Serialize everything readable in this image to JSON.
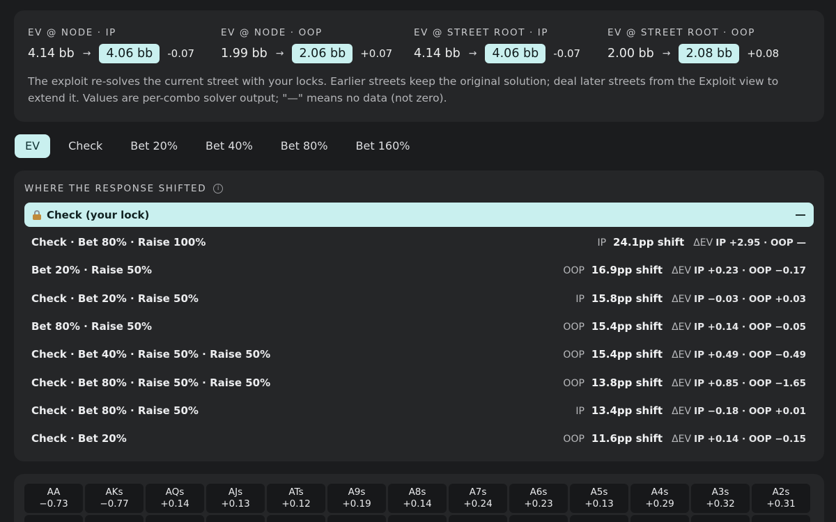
{
  "ev_summary": [
    {
      "label": "EV @ NODE · IP",
      "old": "4.14 bb",
      "arrow": "→",
      "new": "4.06 bb",
      "delta": "-0.07"
    },
    {
      "label": "EV @ NODE · OOP",
      "old": "1.99 bb",
      "arrow": "→",
      "new": "2.06 bb",
      "delta": "+0.07"
    },
    {
      "label": "EV @ STREET ROOT · IP",
      "old": "4.14 bb",
      "arrow": "→",
      "new": "4.06 bb",
      "delta": "-0.07"
    },
    {
      "label": "EV @ STREET ROOT · OOP",
      "old": "2.00 bb",
      "arrow": "→",
      "new": "2.08 bb",
      "delta": "+0.08"
    }
  ],
  "note": "The exploit re-solves the current street with your locks. Earlier streets keep the original solution; deal later streets from the Exploit view to extend it. Values are per-combo solver output; \"—\" means no data (not zero).",
  "tabs": [
    "EV",
    "Check",
    "Bet 20%",
    "Bet 40%",
    "Bet 80%",
    "Bet 160%"
  ],
  "shift_panel": {
    "heading": "WHERE THE RESPONSE SHIFTED",
    "info_glyph": "i",
    "lock_label": "Check (your lock)",
    "delta_label": "ΔEV",
    "rows": [
      {
        "line": "Check · Bet 80% · Raise 100%",
        "pos": "IP",
        "shift": "24.1pp shift",
        "dev": "IP +2.95 · OOP —"
      },
      {
        "line": "Bet 20% · Raise 50%",
        "pos": "OOP",
        "shift": "16.9pp shift",
        "dev": "IP +0.23 · OOP −0.17"
      },
      {
        "line": "Check · Bet 20% · Raise 50%",
        "pos": "IP",
        "shift": "15.8pp shift",
        "dev": "IP −0.03 · OOP +0.03"
      },
      {
        "line": "Bet 80% · Raise 50%",
        "pos": "OOP",
        "shift": "15.4pp shift",
        "dev": "IP +0.14 · OOP −0.05"
      },
      {
        "line": "Check · Bet 40% · Raise 50% · Raise 50%",
        "pos": "OOP",
        "shift": "15.4pp shift",
        "dev": "IP +0.49 · OOP −0.49"
      },
      {
        "line": "Check · Bet 80% · Raise 50% · Raise 50%",
        "pos": "OOP",
        "shift": "13.8pp shift",
        "dev": "IP +0.85 · OOP −1.65"
      },
      {
        "line": "Check · Bet 80% · Raise 50%",
        "pos": "IP",
        "shift": "13.4pp shift",
        "dev": "IP −0.18 · OOP +0.01"
      },
      {
        "line": "Check · Bet 20%",
        "pos": "OOP",
        "shift": "11.6pp shift",
        "dev": "IP +0.14 · OOP −0.15"
      }
    ]
  },
  "hand_grid": [
    {
      "hand": "AA",
      "value": "−0.73"
    },
    {
      "hand": "AKs",
      "value": "−0.77"
    },
    {
      "hand": "AQs",
      "value": "+0.14"
    },
    {
      "hand": "AJs",
      "value": "+0.13"
    },
    {
      "hand": "ATs",
      "value": "+0.12"
    },
    {
      "hand": "A9s",
      "value": "+0.19"
    },
    {
      "hand": "A8s",
      "value": "+0.14"
    },
    {
      "hand": "A7s",
      "value": "+0.24"
    },
    {
      "hand": "A6s",
      "value": "+0.23"
    },
    {
      "hand": "A5s",
      "value": "+0.13"
    },
    {
      "hand": "A4s",
      "value": "+0.29"
    },
    {
      "hand": "A3s",
      "value": "+0.32"
    },
    {
      "hand": "A2s",
      "value": "+0.31"
    }
  ],
  "colors": {
    "accent": "#c9f0ef",
    "panel": "#252628",
    "background": "#1b1c1e",
    "cell": "#17181a"
  }
}
